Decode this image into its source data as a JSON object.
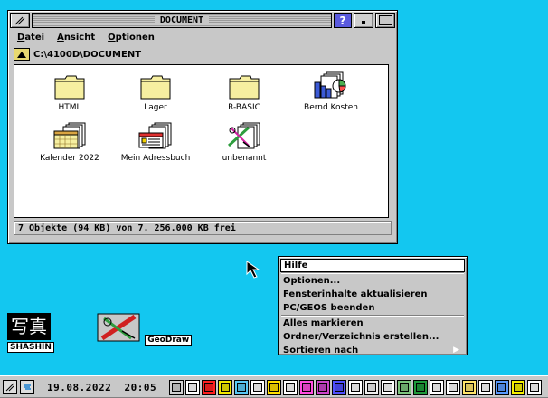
{
  "window": {
    "title": "DOCUMENT",
    "help_label": "?",
    "menu": [
      {
        "label_first": "D",
        "label_rest": "atei"
      },
      {
        "label_first": "A",
        "label_rest": "nsicht"
      },
      {
        "label_first": "O",
        "label_rest": "ptionen"
      }
    ],
    "path": "C:\\4100D\\DOCUMENT",
    "items": [
      {
        "label": "HTML",
        "icon": "folder-icon"
      },
      {
        "label": "Lager",
        "icon": "folder-icon"
      },
      {
        "label": "R-BASIC",
        "icon": "folder-icon"
      },
      {
        "label": "Bernd Kosten",
        "icon": "chart-document-icon"
      },
      {
        "label": "Kalender 2022",
        "icon": "calendar-document-icon"
      },
      {
        "label": "Mein Adressbuch",
        "icon": "addressbook-document-icon"
      },
      {
        "label": "unbenannt",
        "icon": "drawing-document-icon"
      }
    ],
    "status": "7 Objekte (94 KB) von 7.  256.000 KB frei"
  },
  "desktop": {
    "icons": [
      {
        "label": "SHASHIN",
        "glyph": "写真"
      },
      {
        "label": "GeoDraw"
      }
    ]
  },
  "context_menu": {
    "items": [
      {
        "label": "Hilfe",
        "active": true
      },
      {
        "label": "Optionen..."
      },
      {
        "label": "Fensterinhalte aktualisieren"
      },
      {
        "label": "PC/GEOS beenden"
      },
      {
        "label": "Alles markieren"
      },
      {
        "label": "Ordner/Verzeichnis erstellen..."
      },
      {
        "label": "Sortieren nach",
        "submenu": true
      }
    ],
    "submenu_arrow": "▶"
  },
  "taskbar": {
    "date": "19.08.2022",
    "time": "20:05",
    "colors": [
      "#d0d0d0",
      "#ffffff",
      "#ff2020",
      "#f2e600",
      "#5ac8f5",
      "#ffffff",
      "#ffe000",
      "#ffffff",
      "#ff4de1",
      "#cc44cc",
      "#5050ff",
      "#ffffff",
      "#f0f0f0",
      "#ffffff",
      "#7cc47c",
      "#1e9a3a",
      "#ffffff",
      "#ffffff",
      "#ffe46a",
      "#ffffff",
      "#5a9aff",
      "#f6f000",
      "#ffffff"
    ]
  },
  "colors": {
    "desktop": "#13c7f0",
    "window": "#c8c8c8",
    "folder": "#f6efa0"
  }
}
